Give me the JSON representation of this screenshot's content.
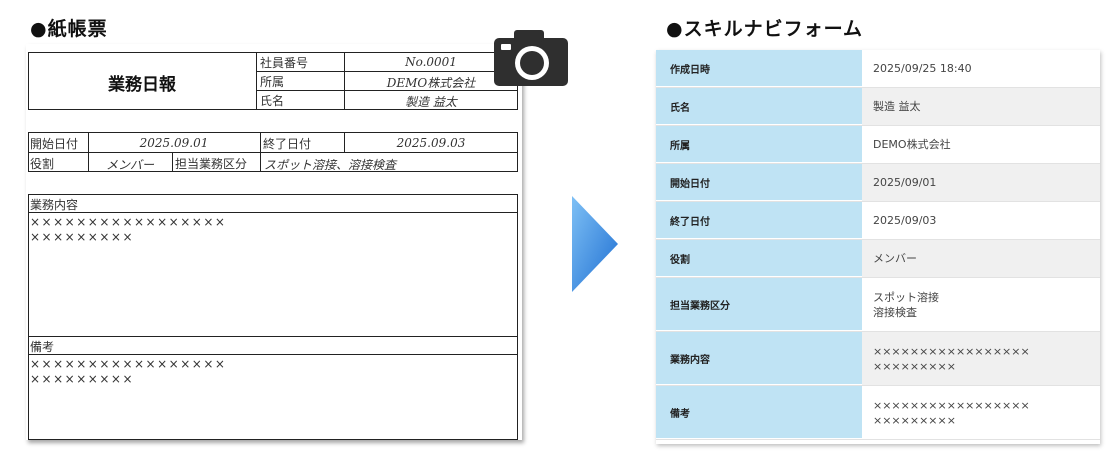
{
  "paper_section": {
    "title": "●紙帳票",
    "form_title": "業務日報",
    "header_rows": [
      {
        "label": "社員番号",
        "value": "No.0001"
      },
      {
        "label": "所属",
        "value": "DEMO株式会社"
      },
      {
        "label": "氏名",
        "value": "製造 益太"
      }
    ],
    "start_date_label": "開始日付",
    "start_date_value": "2025.09.01",
    "end_date_label": "終了日付",
    "end_date_value": "2025.09.03",
    "role_label": "役割",
    "role_value": "メンバー",
    "category_label": "担当業務区分",
    "category_value": "スポット溶接、溶接検査",
    "work_label": "業務内容",
    "work_lines": [
      "×××××××××××××××××",
      "×××××××××"
    ],
    "notes_label": "備考",
    "notes_lines": [
      "×××××××××××××××××",
      "×××××××××"
    ]
  },
  "skillnavi_section": {
    "title": "●スキルナビフォーム",
    "rows": [
      {
        "label": "作成日時",
        "value": "2025/09/25 18:40",
        "value2": ""
      },
      {
        "label": "氏名",
        "value": "製造 益太",
        "value2": ""
      },
      {
        "label": "所属",
        "value": "DEMO株式会社",
        "value2": ""
      },
      {
        "label": "開始日付",
        "value": "2025/09/01",
        "value2": ""
      },
      {
        "label": "終了日付",
        "value": "2025/09/03",
        "value2": ""
      },
      {
        "label": "役割",
        "value": "メンバー",
        "value2": ""
      },
      {
        "label": "担当業務区分",
        "value": "スポット溶接",
        "value2": "溶接検査"
      },
      {
        "label": "業務内容",
        "value": "×××××××××××××××××",
        "value2": "×××××××××"
      },
      {
        "label": "備考",
        "value": "×××××××××××××××××",
        "value2": "×××××××××"
      }
    ]
  },
  "colors": {
    "label_bg": "#bfe3f4",
    "arrow": "#2f86e0",
    "camera": "#2f2f2f",
    "flash": "#f5e64a"
  },
  "icons": {
    "camera": "camera-icon",
    "arrow": "arrow-right-icon"
  }
}
